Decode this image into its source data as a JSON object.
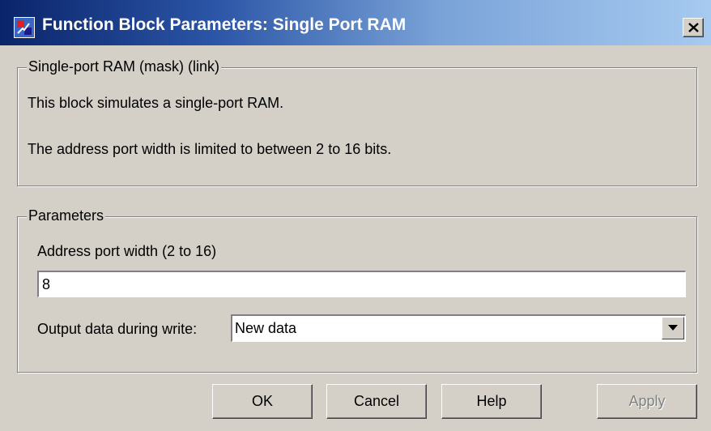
{
  "window": {
    "title": "Function Block Parameters: Single Port RAM",
    "close_glyph": "×"
  },
  "description_group": {
    "legend": "Single-port RAM (mask) (link)",
    "line1": "This block simulates a single-port RAM.",
    "line2": "The address port width is limited to between 2 to 16 bits."
  },
  "parameters_group": {
    "legend": "Parameters",
    "address_label": "Address port width (2 to 16)",
    "address_value": "8",
    "output_label": "Output data during write:",
    "output_value": "New data"
  },
  "buttons": {
    "ok": "OK",
    "cancel": "Cancel",
    "help": "Help",
    "apply": "Apply"
  },
  "colors": {
    "face": "#d4d0c8",
    "title_start": "#0a246a",
    "title_end": "#a6caf0",
    "disabled_text": "#808080"
  },
  "icons": {
    "app": "simulink-block-icon",
    "close": "close-icon",
    "dropdown": "chevron-down-icon"
  }
}
